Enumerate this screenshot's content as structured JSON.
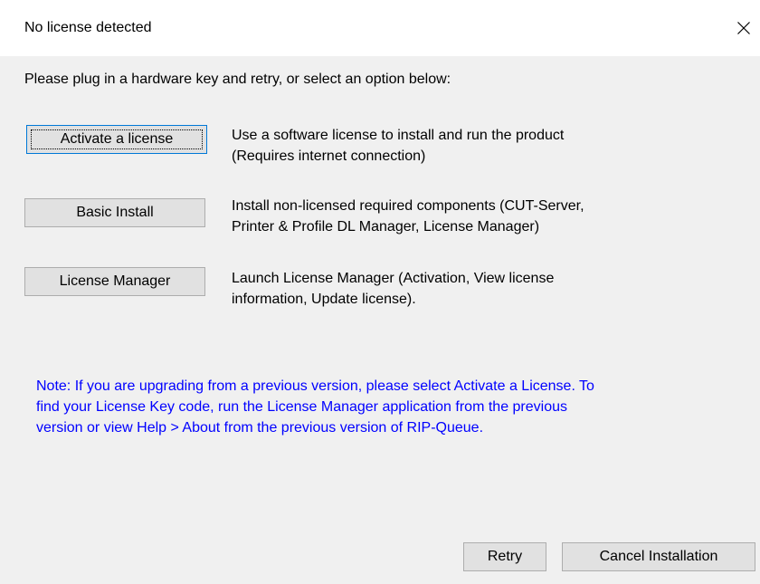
{
  "window": {
    "title": "No license detected",
    "close_glyph": "×"
  },
  "prompt": "Please plug in a hardware key and retry, or select an option below:",
  "options": [
    {
      "button_label": "Activate a license",
      "description_line1": "Use a software license to install and run the product",
      "description_line2": "(Requires internet connection)"
    },
    {
      "button_label": "Basic Install",
      "description_line1": "Install non-licensed required components (CUT-Server,",
      "description_line2": "Printer & Profile DL Manager, License Manager)"
    },
    {
      "button_label": "License Manager",
      "description_line1": "Launch License Manager (Activation, View license",
      "description_line2": "information, Update license)."
    }
  ],
  "note": {
    "line1": "Note: If you are upgrading from a previous version, please select Activate a License. To",
    "line2": "find your License Key code, run the License Manager application from the previous",
    "line3": "version or view Help > About from the previous version of RIP-Queue.",
    "color": "#0000ff"
  },
  "footer": {
    "retry_label": "Retry",
    "cancel_label": "Cancel Installation"
  },
  "icons": {
    "close": "close-icon"
  }
}
